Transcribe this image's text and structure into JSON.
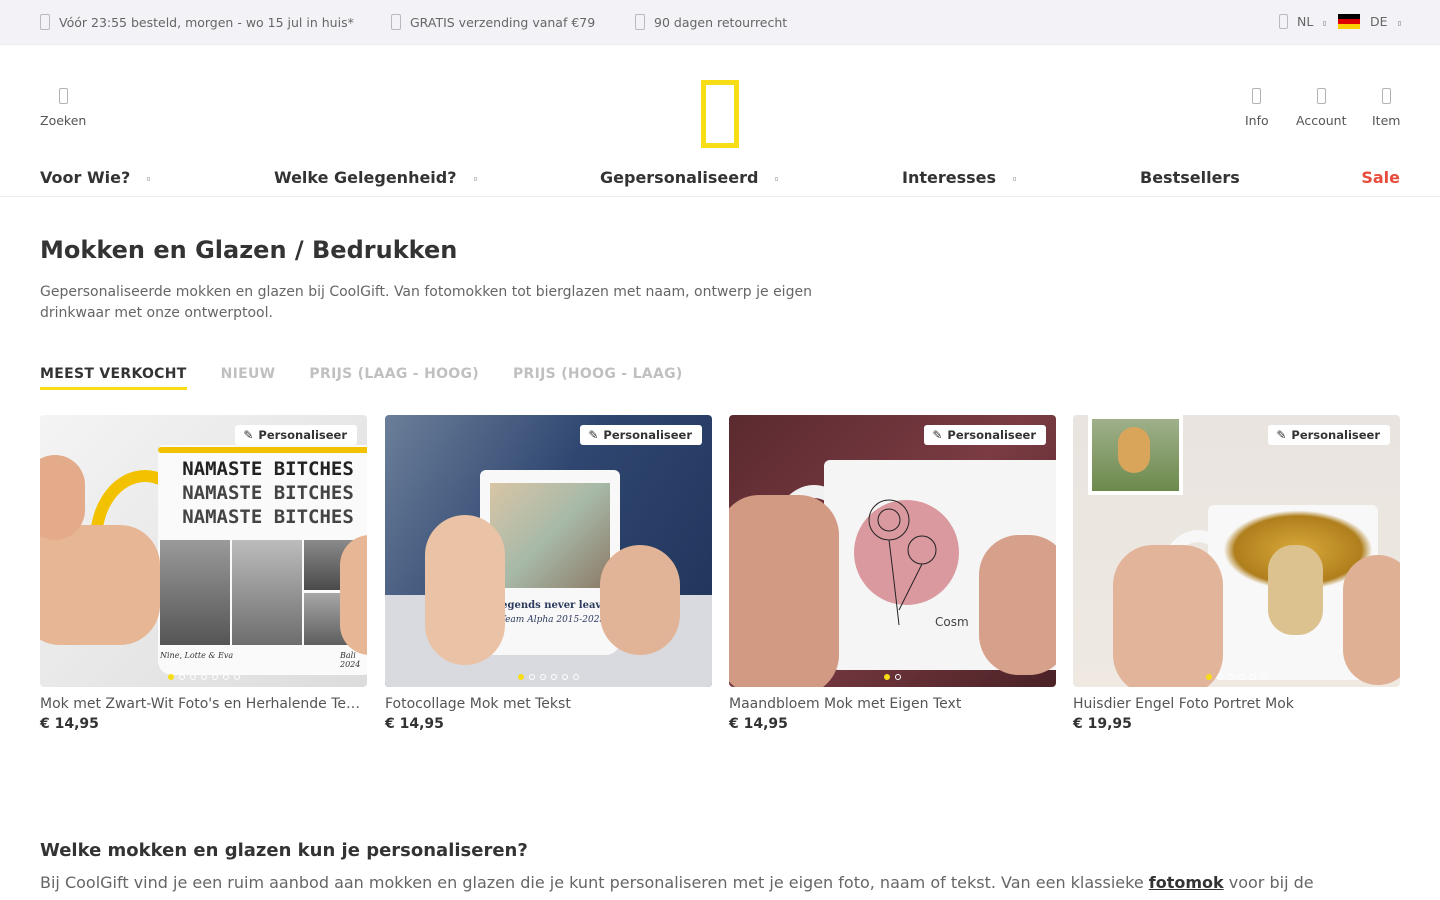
{
  "topbar": {
    "usps": [
      "Vóór 23:55 besteld, morgen - wo 15 jul in huis*",
      "GRATIS verzending vanaf €79",
      "90 dagen retourrecht"
    ],
    "language": "NL",
    "country": "DE"
  },
  "header": {
    "search_label": "Zoeken",
    "info_label": "Info",
    "account_label": "Account",
    "cart_label": "Item"
  },
  "nav": {
    "items": [
      "Voor Wie?",
      "Welke Gelegenheid?",
      "Gepersonaliseerd",
      "Interesses",
      "Bestsellers",
      "Sale"
    ]
  },
  "page": {
    "title": "Mokken en Glazen / Bedrukken",
    "intro": "Gepersonaliseerde mokken en glazen bij CoolGift. Van fotomokken tot bierglazen met naam, ontwerp je eigen drinkwaar met onze ontwerptool."
  },
  "sort": {
    "tabs": [
      "MEEST VERKOCHT",
      "NIEUW",
      "PRIJS (LAAG - HOOG)",
      "PRIJS (HOOG - LAAG)"
    ],
    "active": "MEEST VERKOCHT"
  },
  "products": [
    {
      "name": "Mok met Zwart-Wit Foto's en Herhalende Tekst",
      "price": "€ 14,95",
      "tag": "Personaliseer",
      "mug_lines": [
        "NAMASTE BITCHES",
        "NAMASTE BITCHES",
        "NAMASTE BITCHES"
      ],
      "mug_caption_left": "Nine, Lotte & Eva",
      "mug_caption_right": "Bali 2024",
      "image_count": 7,
      "active_image": 1
    },
    {
      "name": "Fotocollage Mok met Tekst",
      "price": "€ 14,95",
      "tag": "Personaliseer",
      "mug_text": "legends never leave",
      "mug_subtext": "Team Alpha 2015-2025",
      "image_count": 6,
      "active_image": 1
    },
    {
      "name": "Maandbloem Mok met Eigen Text",
      "price": "€ 14,95",
      "tag": "Personaliseer",
      "mug_text": "Cosm",
      "image_count": 2,
      "active_image": 1
    },
    {
      "name": "Huisdier Engel Foto Portret Mok",
      "price": "€ 19,95",
      "tag": "Personaliseer",
      "image_count": 6,
      "active_image": 1
    }
  ],
  "section": {
    "title": "Welke mokken en glazen kun je personaliseren?",
    "text_before": "Bij CoolGift vind je een ruim aanbod aan mokken en glazen die je kunt personaliseren met je eigen foto, naam of tekst. Van een klassieke ",
    "link": "fotomok",
    "text_after": " voor bij de"
  },
  "colors": {
    "accent": "#f7dd15",
    "sale": "#e74c3c",
    "topbar_bg": "#f3f2f6"
  }
}
